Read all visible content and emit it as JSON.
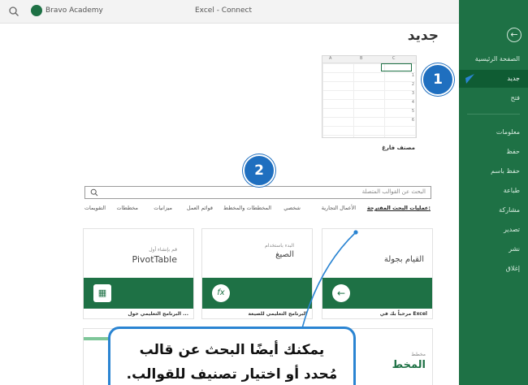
{
  "titlebar": {
    "user": "Bravo Academy",
    "title": "Excel - Connect"
  },
  "sidebar": {
    "back_glyph": "←",
    "items": [
      "الصفحة الرئيسية",
      "جديد",
      "فتح",
      "معلومات",
      "حفظ",
      "حفظ باسم",
      "طباعة",
      "مشاركة",
      "تصدير",
      "نشر",
      "إغلاق"
    ]
  },
  "heading": "جديد",
  "blank_workbook": {
    "cols": [
      "A",
      "B",
      "C"
    ],
    "rows": [
      "1",
      "2",
      "3",
      "4",
      "5",
      "6"
    ],
    "label": "مصنف فارغ"
  },
  "search": {
    "placeholder": "البحث عن القوالب المتصلة"
  },
  "suggested": {
    "lead": "عمليات البحث المقترحة:",
    "items": [
      "الأعمال التجارية",
      "شخصي",
      "المخططات والمخطط",
      "قوائم العمل",
      "ميزانيات",
      "مخططات",
      "التقويمات"
    ]
  },
  "cards": [
    {
      "title": "القيام بجولة",
      "sub": "",
      "icon": "←",
      "caption": "مرحباً بك في Excel"
    },
    {
      "title": "الصيغ",
      "sub": "البدء باستخدام",
      "icon": "fx",
      "caption": "البرنامج التعليمي للصيغة"
    },
    {
      "title": "PivotTable",
      "sub": "قم بإنشاء أول",
      "icon": "▦",
      "caption": "البرنامج التعليمي حول ..."
    }
  ],
  "partial_card": {
    "small": "مخطط",
    "big": "المخط"
  },
  "badges": {
    "one": "1",
    "two": "2"
  },
  "callout": {
    "line1": "يمكنك أيضًا البحث عن قالب",
    "line2": "مُحدد أو اختيار تصنيف للقوالب."
  },
  "colors": {
    "excel_green": "#1e7145",
    "badge_blue": "#1f6fbf",
    "callout_border": "#2a84d2"
  }
}
